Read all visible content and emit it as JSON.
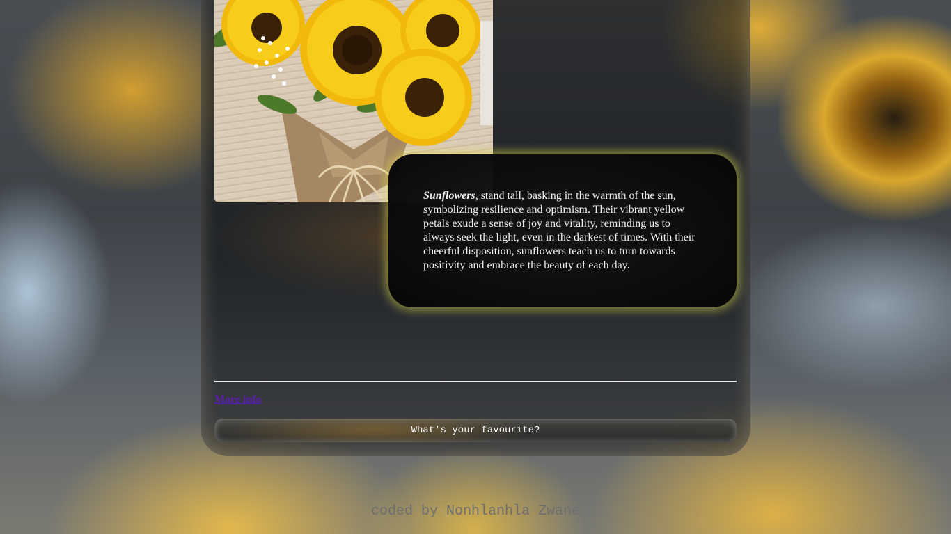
{
  "main": {
    "photo_alt": "Bouquet of sunflowers",
    "description": {
      "highlight": "Sunflowers",
      "body": ", stand tall, basking in the warmth of the sun, symbolizing resilience and optimism. Their vibrant yellow petals exude a sense of joy and vitality, reminding us to always seek the light, even in the darkest of times. With their cheerful disposition, sunflowers teach us to turn towards positivity and embrace the beauty of each day."
    },
    "more_info_link": "More info",
    "favourite_button": "What's your favourite?"
  },
  "footer": {
    "credit": "coded by Nonhlanhla Zwane"
  },
  "colors": {
    "glow": "#e6e150",
    "link": "#5b1fa8",
    "petal": "#f5c20c",
    "center": "#3a2208"
  }
}
